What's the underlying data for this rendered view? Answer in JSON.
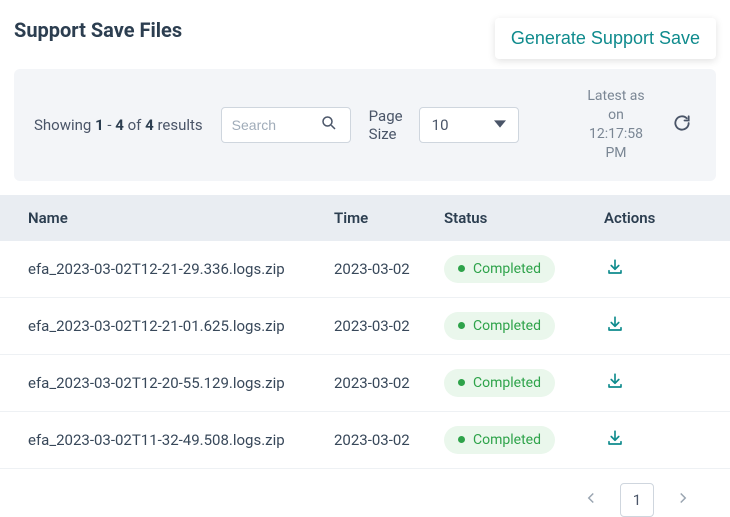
{
  "header": {
    "title": "Support Save Files",
    "generate_label": "Generate Support Save"
  },
  "toolbar": {
    "showing_prefix": "Showing ",
    "range_start": "1",
    "range_sep": " - ",
    "range_end": "4",
    "of_text": " of ",
    "total": "4",
    "results_text": " results",
    "search_placeholder": "Search",
    "pagesize_label": "Page Size",
    "pagesize_value": "10",
    "latest_line1": "Latest as on",
    "latest_line2": "12:17:58 PM"
  },
  "table": {
    "headers": {
      "name": "Name",
      "time": "Time",
      "status": "Status",
      "actions": "Actions"
    },
    "rows": [
      {
        "name": "efa_2023-03-02T12-21-29.336.logs.zip",
        "time": "2023-03-02",
        "status": "Completed"
      },
      {
        "name": "efa_2023-03-02T12-21-01.625.logs.zip",
        "time": "2023-03-02",
        "status": "Completed"
      },
      {
        "name": "efa_2023-03-02T12-20-55.129.logs.zip",
        "time": "2023-03-02",
        "status": "Completed"
      },
      {
        "name": "efa_2023-03-02T11-32-49.508.logs.zip",
        "time": "2023-03-02",
        "status": "Completed"
      }
    ]
  },
  "pager": {
    "current": "1"
  }
}
